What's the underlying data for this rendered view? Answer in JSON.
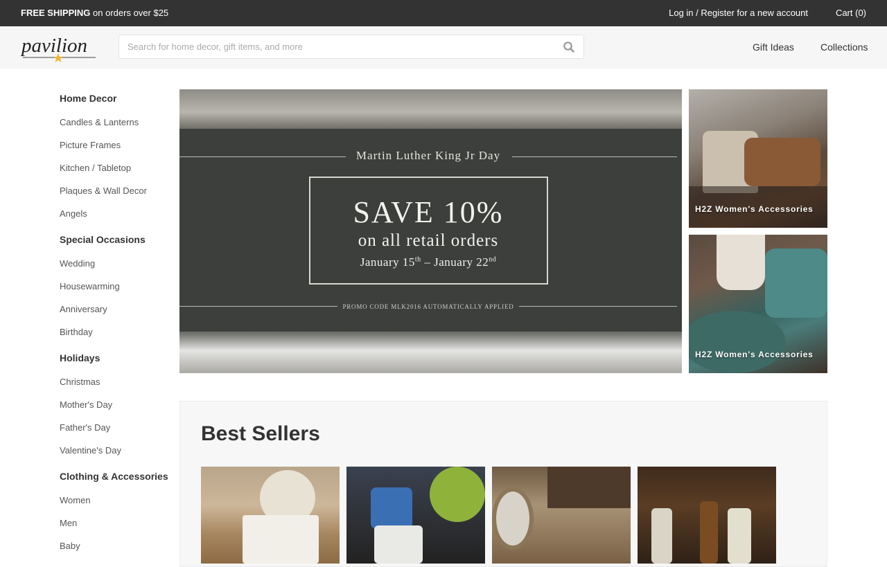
{
  "topbar": {
    "promo_bold": "FREE SHIPPING",
    "promo_rest": " on orders over $25",
    "login_label": "Log in / Register for a new account",
    "cart_label": "Cart (0)"
  },
  "header": {
    "logo_text": "pavilion",
    "search_placeholder": "Search for home decor, gift items, and more",
    "search_value": "",
    "nav": [
      "Gift Ideas",
      "Collections"
    ]
  },
  "sidebar": {
    "groups": [
      {
        "heading": "Home Decor",
        "items": [
          "Candles & Lanterns",
          "Picture Frames",
          "Kitchen / Tabletop",
          "Plaques & Wall Decor",
          "Angels"
        ]
      },
      {
        "heading": "Special Occasions",
        "items": [
          "Wedding",
          "Housewarming",
          "Anniversary",
          "Birthday"
        ]
      },
      {
        "heading": "Holidays",
        "items": [
          "Christmas",
          "Mother's Day",
          "Father's Day",
          "Valentine's Day"
        ]
      },
      {
        "heading": "Clothing & Accessories",
        "items": [
          "Women",
          "Men",
          "Baby"
        ]
      }
    ]
  },
  "hero": {
    "heading": "Martin Luther King Jr Day",
    "save": "SAVE 10%",
    "subline": "on all retail orders",
    "dates_start": "January 15",
    "dates_start_sup": "th",
    "dates_sep": " – January 22",
    "dates_end_sup": "nd",
    "promo": "PROMO CODE MLK2016 AUTOMATICALLY APPLIED"
  },
  "tiles": [
    {
      "caption": "H2Z Women's Accessories"
    },
    {
      "caption": "H2Z Women's Accessories"
    }
  ],
  "bestsellers": {
    "title": "Best Sellers"
  },
  "colors": {
    "topbar_bg": "#333333",
    "header_bg": "#f6f6f6",
    "logo_star": "#f0b43a"
  },
  "icons": {
    "search": "search-icon",
    "logo_star": "star-icon"
  }
}
